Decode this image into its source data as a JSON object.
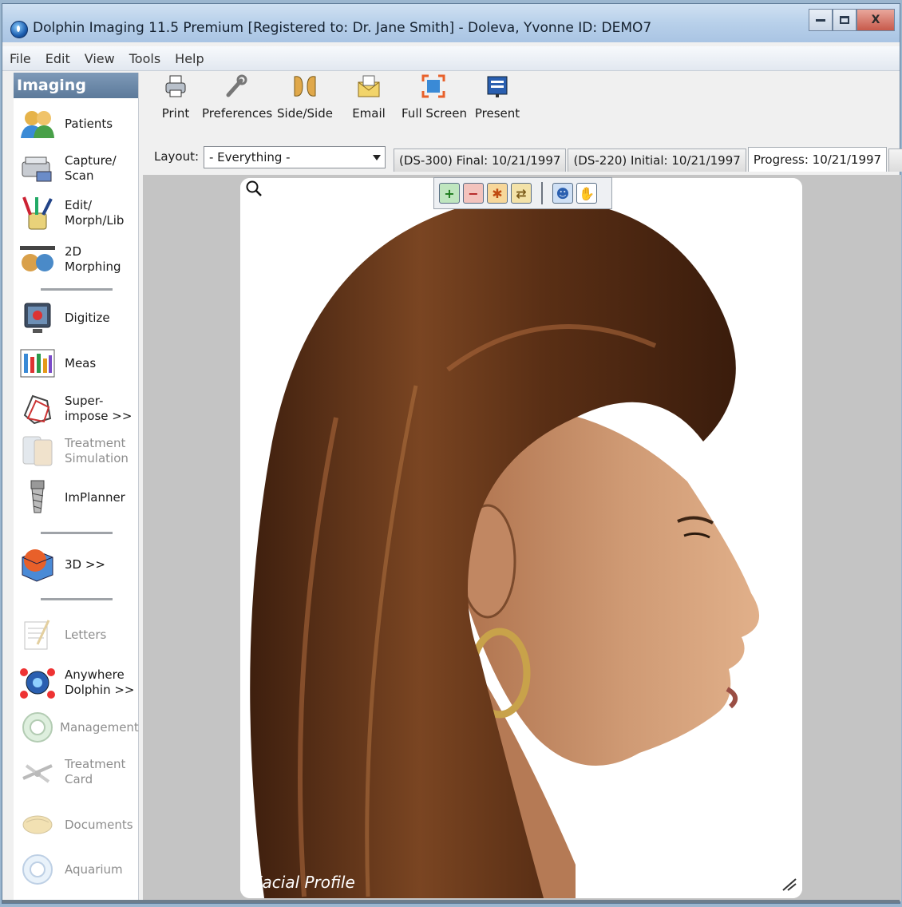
{
  "window": {
    "title": "Dolphin Imaging 11.5 Premium [Registered to: Dr. Jane Smith] - Doleva, Yvonne  ID: DEMO7",
    "minimize_icon": "minimize-icon",
    "maximize_icon": "maximize-icon",
    "close_glyph": "X"
  },
  "menu": [
    "File",
    "Edit",
    "View",
    "Tools",
    "Help"
  ],
  "sidebar": {
    "header": "Imaging",
    "items": [
      {
        "label": "Patients",
        "icon": "patients-icon"
      },
      {
        "label": "Capture/\nScan",
        "icon": "scanner-icon"
      },
      {
        "label": "Edit/\nMorph/Lib",
        "icon": "brushes-icon"
      },
      {
        "label": "2D Morphing",
        "icon": "faces-icon"
      },
      {
        "label": "Digitize",
        "icon": "monitor-icon"
      },
      {
        "label": "Meas",
        "icon": "chart-icon"
      },
      {
        "label": "Super-\nimpose >>",
        "icon": "superimpose-icon"
      },
      {
        "label": "Treatment\nSimulation",
        "icon": "simulation-icon"
      },
      {
        "label": "ImPlanner",
        "icon": "implant-icon"
      },
      {
        "label": "3D >>",
        "icon": "cube-icon"
      },
      {
        "label": "Letters",
        "icon": "letter-icon"
      },
      {
        "label": "Anywhere\nDolphin >>",
        "icon": "network-icon"
      },
      {
        "label": "Management",
        "icon": "management-icon"
      },
      {
        "label": "Treatment\nCard",
        "icon": "card-icon"
      },
      {
        "label": "Documents",
        "icon": "documents-icon"
      },
      {
        "label": "Aquarium",
        "icon": "aquarium-icon"
      }
    ]
  },
  "toolbar": {
    "print": "Print",
    "preferences": "Preferences",
    "side_side": "Side/Side",
    "email": "Email",
    "full_screen": "Full Screen",
    "present": "Present"
  },
  "layout": {
    "label": "Layout:",
    "value": "- Everything -"
  },
  "tabs": [
    "(DS-300) Final: 10/21/1997",
    "(DS-220) Initial: 10/21/1997",
    "Progress: 10/21/1997"
  ],
  "image_tools": [
    "zoom-in-icon",
    "zoom-out-icon",
    "fit-icon",
    "flip-icon",
    "portrait-icon",
    "hand-icon"
  ],
  "viewer": {
    "caption": "Facial Profile"
  },
  "colors": {
    "hair": "#6b3a1e",
    "skin": "#c8916a",
    "sidebar_header": "#6b88a8",
    "viewer_bg": "#c4c4c4"
  }
}
